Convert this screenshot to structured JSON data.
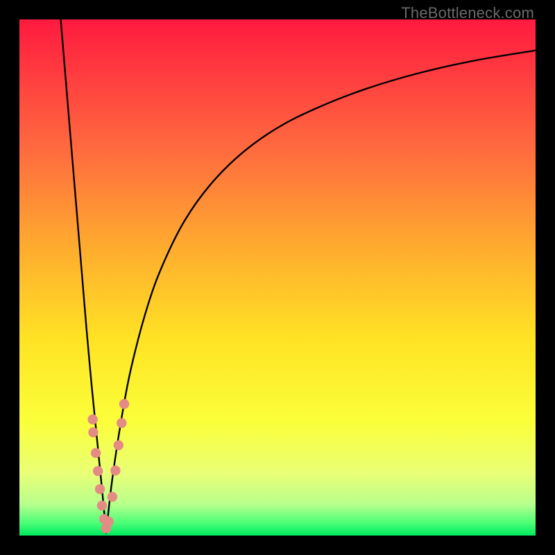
{
  "watermark": {
    "text": "TheBottleneck.com"
  },
  "colors": {
    "frame": "#000000",
    "curve": "#000000",
    "marker_fill": "#e48b86",
    "marker_stroke": "#c96a64",
    "gradient_stops": [
      {
        "offset": 0.0,
        "color": "#ff1a3f"
      },
      {
        "offset": 0.1,
        "color": "#ff3a3f"
      },
      {
        "offset": 0.25,
        "color": "#ff6a3f"
      },
      {
        "offset": 0.45,
        "color": "#ffae2e"
      },
      {
        "offset": 0.62,
        "color": "#ffe324"
      },
      {
        "offset": 0.78,
        "color": "#fbff3a"
      },
      {
        "offset": 0.88,
        "color": "#e9ff76"
      },
      {
        "offset": 0.94,
        "color": "#b6ff8d"
      },
      {
        "offset": 0.975,
        "color": "#4dff77"
      },
      {
        "offset": 1.0,
        "color": "#00e85e"
      }
    ]
  },
  "chart_data": {
    "type": "line",
    "title": "",
    "xlabel": "",
    "ylabel": "",
    "xlim": [
      0,
      100
    ],
    "ylim": [
      0,
      100
    ],
    "series": [
      {
        "name": "left-branch",
        "x": [
          8.0,
          9.0,
          10.0,
          11.0,
          12.0,
          13.0,
          14.0,
          15.0,
          16.0,
          16.8
        ],
        "y": [
          100,
          88,
          76,
          64,
          52,
          40,
          29,
          19,
          9,
          0.5
        ]
      },
      {
        "name": "right-branch",
        "x": [
          16.8,
          18,
          20,
          22,
          25,
          28,
          32,
          37,
          43,
          50,
          58,
          67,
          77,
          88,
          100
        ],
        "y": [
          0.5,
          11,
          24,
          34,
          45,
          53,
          61,
          68,
          74,
          79,
          83,
          86.5,
          89.5,
          92,
          94
        ]
      }
    ],
    "markers": {
      "name": "highlighted-points",
      "x": [
        14.2,
        14.3,
        14.8,
        15.2,
        15.6,
        16.0,
        16.4,
        16.8,
        17.3,
        18.0,
        18.6,
        19.2,
        19.8,
        20.3
      ],
      "y": [
        22.5,
        20.0,
        16.0,
        12.5,
        9.0,
        5.8,
        3.2,
        1.4,
        2.7,
        7.5,
        12.6,
        17.5,
        21.8,
        25.5
      ]
    }
  }
}
